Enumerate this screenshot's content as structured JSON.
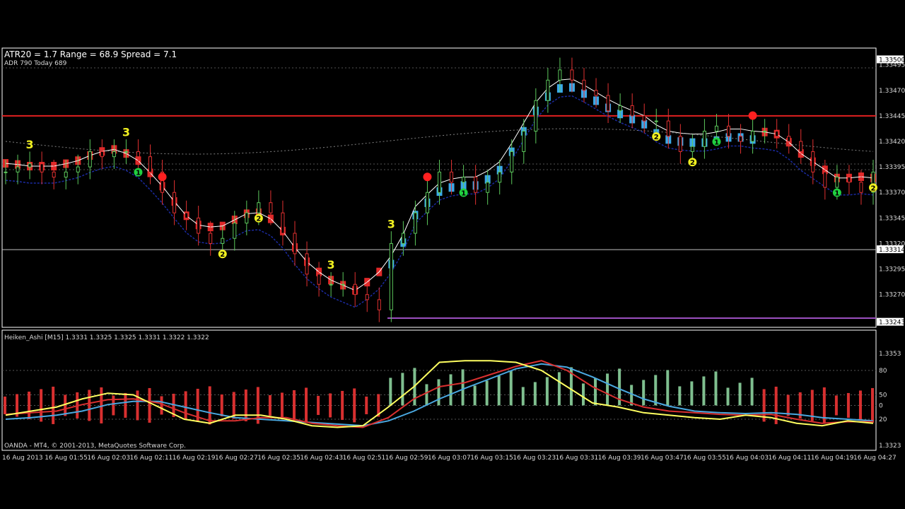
{
  "colors": {
    "background": "#000000",
    "frame": "#ffffff",
    "bull_candle": "#5cc85c",
    "bear_candle": "#e03030",
    "red_band": "#e02828",
    "blue_band": "#3aa8e8",
    "resistance_line": "#e02020",
    "support_line": "#c0c0c0",
    "low_line": "#9b4fbf",
    "green_hist": "#7fbf8f",
    "red_hist": "#d83030",
    "yellow": "#ffff60",
    "cyan": "#4aa8e0",
    "marker_yellow": "#f0f020",
    "marker_green": "#20d040",
    "marker_red": "#ff2020"
  },
  "header": {
    "line1": "ATR20 = 1.7 Range = 68.9 Spread = 7.1",
    "line2": "ADR 790  Today 689"
  },
  "main_axis": {
    "labels": [
      "1.33495",
      "1.33470",
      "1.33445",
      "1.33420",
      "1.33395",
      "1.33370",
      "1.33345",
      "1.33320",
      "1.33295",
      "1.33270"
    ],
    "top_tag": "1.33500",
    "resistance_price": 1.33445,
    "support_tag": "1.33314",
    "support_price": 1.33314,
    "bottom_tag": "1.33243",
    "low_price": 1.33243
  },
  "indicator": {
    "title": "Heiken_Ashi [M15]  1.3331 1.3325 1.3325 1.3331 1.3322 1.3322",
    "copyright": "OANDA - MT4, © 2001-2013, MetaQuotes Software Corp.",
    "axis_labels": [
      "1.3353",
      "80",
      "50",
      "0",
      "20",
      "1.3323"
    ]
  },
  "time_axis": [
    "16 Aug 2013",
    "16 Aug 01:55",
    "16 Aug 02:03",
    "16 Aug 02:11",
    "16 Aug 02:19",
    "16 Aug 02:27",
    "16 Aug 02:35",
    "16 Aug 02:43",
    "16 Aug 02:51",
    "16 Aug 02:59",
    "16 Aug 03:07",
    "16 Aug 03:15",
    "16 Aug 03:23",
    "16 Aug 03:31",
    "16 Aug 03:39",
    "16 Aug 03:47",
    "16 Aug 03:55",
    "16 Aug 04:03",
    "16 Aug 04:11",
    "16 Aug 04:19",
    "16 Aug 04:27"
  ],
  "chart_data": {
    "type": "candlestick",
    "symbol_timeframe": "M15",
    "ylim": [
      1.3324,
      1.3351
    ],
    "close": [
      1.3339,
      1.33395,
      1.33398,
      1.3339,
      1.33385,
      1.3339,
      1.33395,
      1.3341,
      1.33405,
      1.3341,
      1.3341,
      1.33405,
      1.3339,
      1.3337,
      1.3335,
      1.33345,
      1.3333,
      1.3332,
      1.33325,
      1.3334,
      1.3335,
      1.3336,
      1.3335,
      1.3333,
      1.3331,
      1.3329,
      1.3328,
      1.3328,
      1.3328,
      1.3327,
      1.33265,
      1.33255,
      1.3332,
      1.3333,
      1.3335,
      1.3337,
      1.3339,
      1.3338,
      1.33385,
      1.3337,
      1.3338,
      1.3339,
      1.3341,
      1.3343,
      1.3346,
      1.3348,
      1.3349,
      1.3348,
      1.3347,
      1.33465,
      1.3345,
      1.33455,
      1.33445,
      1.3344,
      1.3344,
      1.33425,
      1.3341,
      1.33415,
      1.3343,
      1.33435,
      1.33425,
      1.3342,
      1.3343,
      1.3343,
      1.33425,
      1.3342,
      1.3341,
      1.3339,
      1.33375,
      1.33385,
      1.3338,
      1.3337,
      1.3339
    ],
    "markers": [
      {
        "label": "3",
        "type": "yellow-text"
      },
      {
        "label": "3",
        "type": "yellow-text"
      },
      {
        "label": "1",
        "type": "green"
      },
      {
        "label": "",
        "type": "red"
      },
      {
        "label": "2",
        "type": "yellow"
      },
      {
        "label": "2",
        "type": "yellow"
      },
      {
        "label": "3",
        "type": "yellow-text"
      },
      {
        "label": "",
        "type": "red"
      },
      {
        "label": "1",
        "type": "green"
      },
      {
        "label": "3",
        "type": "yellow-text"
      },
      {
        "label": "2",
        "type": "yellow"
      },
      {
        "label": "2",
        "type": "yellow"
      },
      {
        "label": "1",
        "type": "green"
      },
      {
        "label": "",
        "type": "red"
      },
      {
        "label": "1",
        "type": "green"
      },
      {
        "label": "2",
        "type": "yellow"
      }
    ],
    "ha_direction": [
      -1,
      -1,
      -1,
      -1,
      -1,
      -1,
      -1,
      -1,
      -1,
      -1,
      -1,
      -1,
      -1,
      -1,
      -1,
      -1,
      -1,
      -1,
      -1,
      -1,
      -1,
      -1,
      -1,
      -1,
      -1,
      -1,
      -1,
      -1,
      -1,
      -1,
      -1,
      -1,
      1,
      1,
      1,
      1,
      1,
      1,
      1,
      1,
      1,
      1,
      1,
      1,
      1,
      1,
      1,
      1,
      1,
      1,
      1,
      1,
      1,
      1,
      1,
      1,
      1,
      1,
      1,
      1,
      1,
      1,
      1,
      -1,
      -1,
      -1,
      -1,
      -1,
      -1,
      -1,
      -1,
      -1,
      -1
    ],
    "stoch_yellow": [
      25,
      30,
      35,
      45,
      52,
      50,
      35,
      20,
      15,
      25,
      25,
      20,
      12,
      10,
      12,
      35,
      60,
      90,
      92,
      92,
      90,
      80,
      60,
      40,
      35,
      28,
      25,
      22,
      20,
      25,
      22,
      15,
      12,
      18,
      15
    ],
    "stoch_red": [
      26,
      28,
      30,
      38,
      44,
      45,
      40,
      28,
      18,
      18,
      22,
      22,
      15,
      12,
      10,
      22,
      45,
      60,
      65,
      75,
      85,
      92,
      80,
      60,
      45,
      35,
      30,
      28,
      26,
      25,
      26,
      20,
      15,
      17,
      17
    ],
    "stoch_blue": [
      20,
      22,
      25,
      30,
      38,
      42,
      42,
      35,
      28,
      22,
      20,
      18,
      16,
      14,
      12,
      18,
      30,
      45,
      58,
      70,
      82,
      88,
      84,
      72,
      58,
      45,
      36,
      30,
      28,
      27,
      28,
      26,
      22,
      20,
      18
    ]
  }
}
